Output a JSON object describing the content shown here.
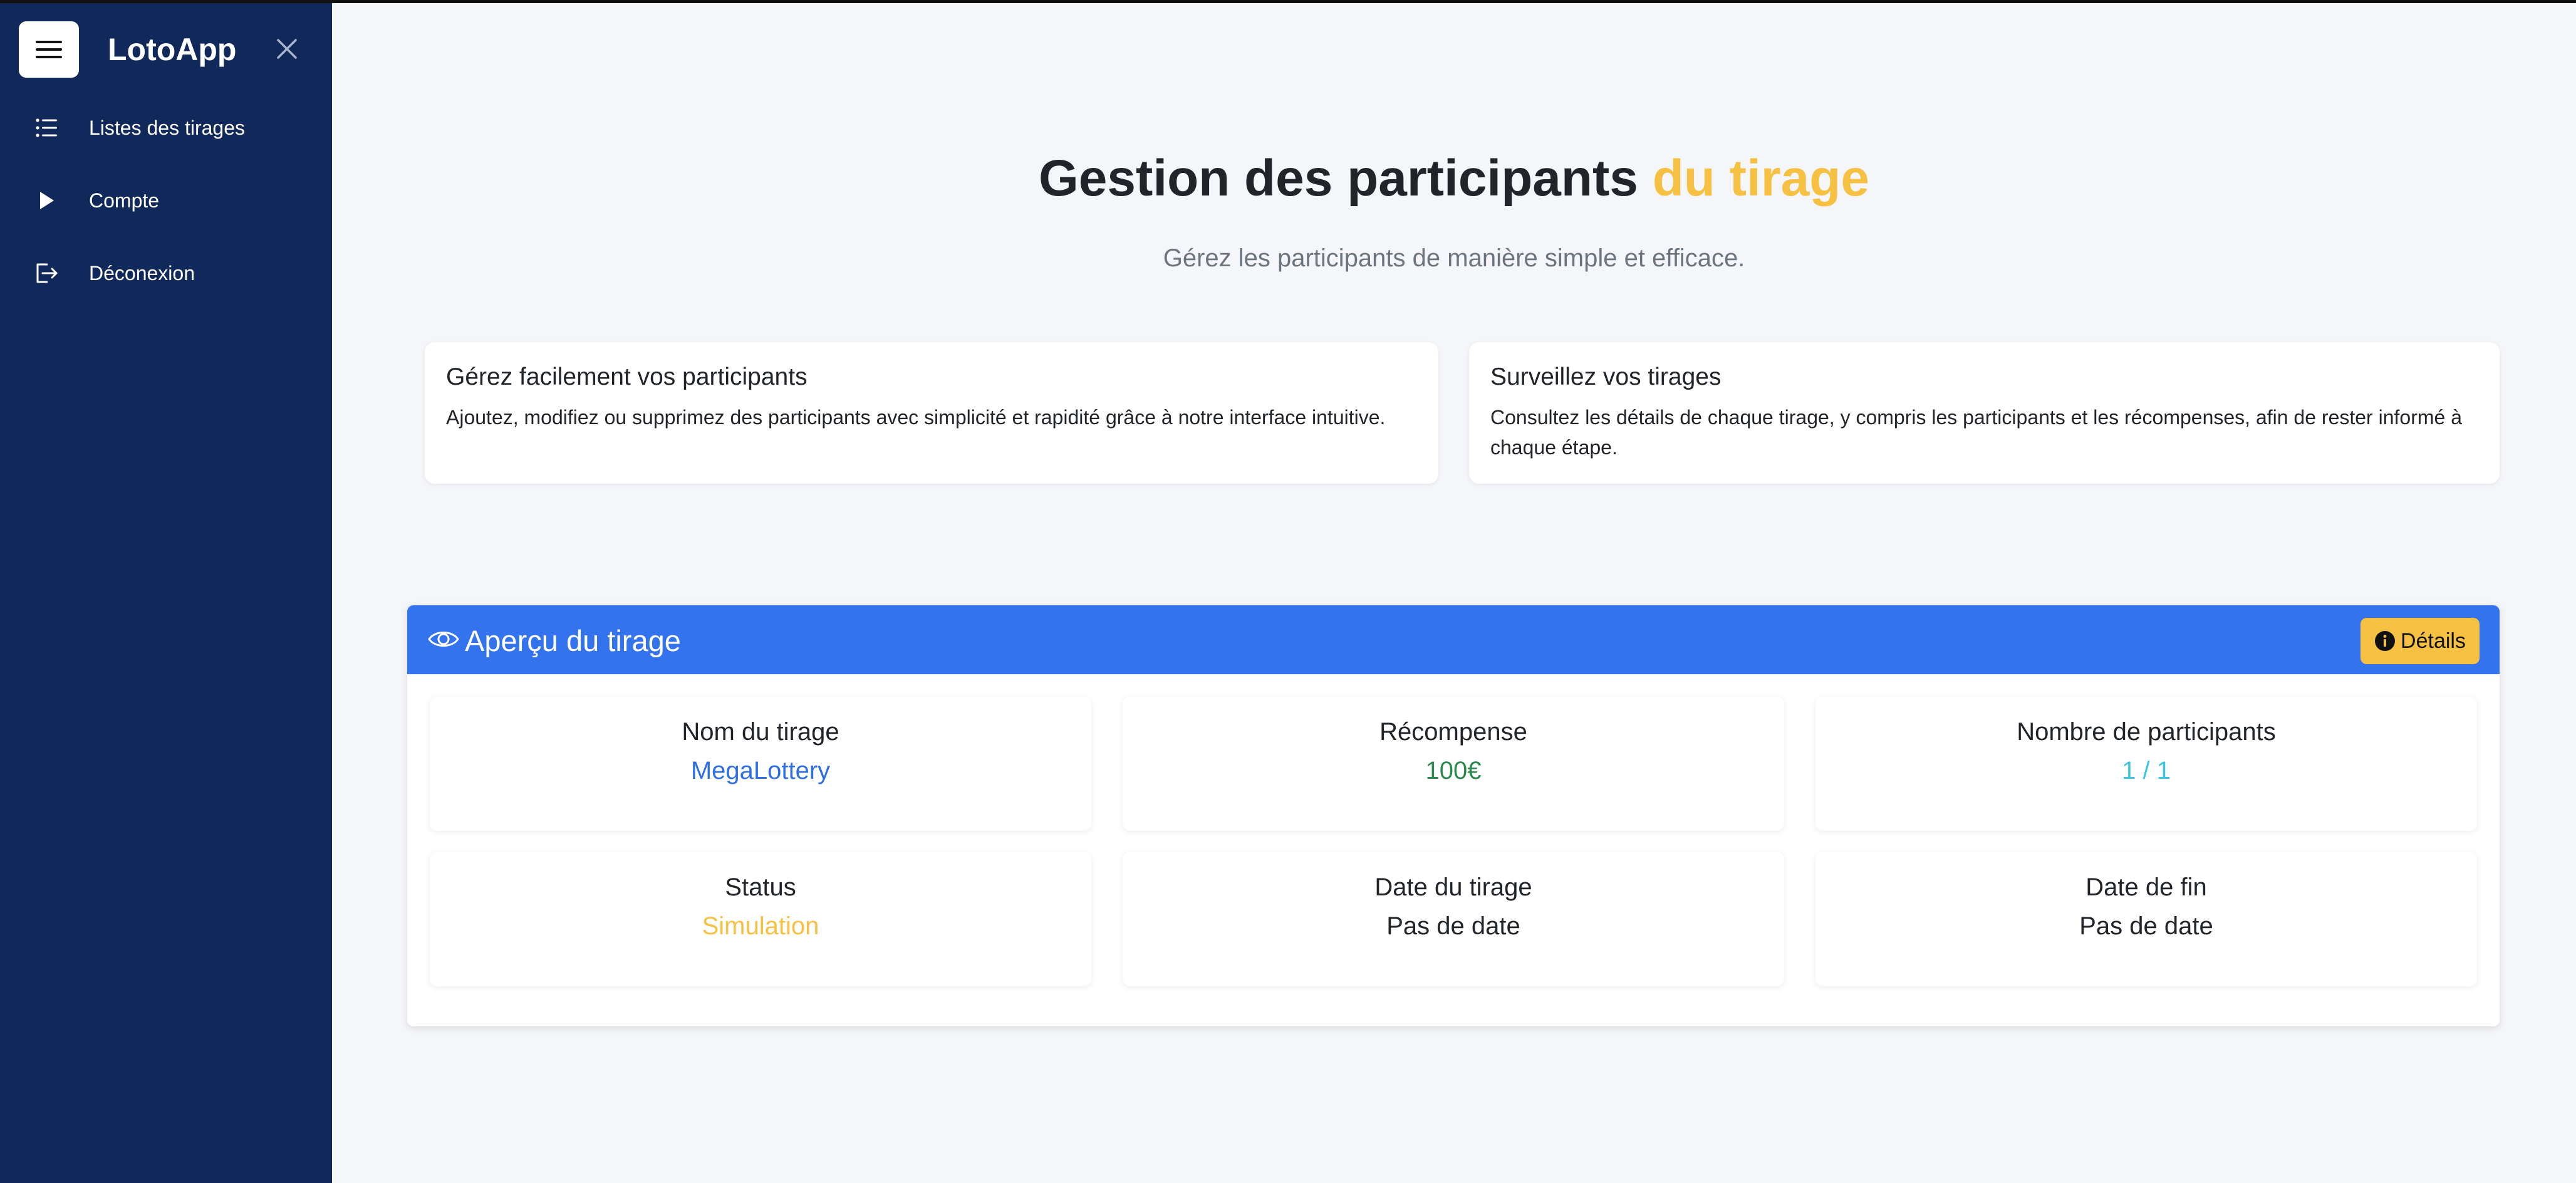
{
  "app": {
    "brand": "LotoApp"
  },
  "sidebar": {
    "items": [
      {
        "label": "Listes des tirages",
        "icon": "list-icon"
      },
      {
        "label": "Compte",
        "icon": "play-icon"
      },
      {
        "label": "Déconexion",
        "icon": "logout-icon"
      }
    ]
  },
  "hero": {
    "title_main": "Gestion des participants",
    "title_accent": "du tirage",
    "subtitle": "Gérez les participants de manière simple et efficace."
  },
  "features": [
    {
      "title": "Gérez facilement vos participants",
      "text": "Ajoutez, modifiez ou supprimez des participants avec simplicité et rapidité grâce à notre interface intuitive."
    },
    {
      "title": "Surveillez vos tirages",
      "text": "Consultez les détails de chaque tirage, y compris les participants et les récompenses, afin de rester informé à chaque étape."
    }
  ],
  "overview": {
    "title": "Aperçu du tirage",
    "details_label": "Détails",
    "stats": [
      {
        "label": "Nom du tirage",
        "value": "MegaLottery",
        "color": "#2f6fe4"
      },
      {
        "label": "Récompense",
        "value": "100€",
        "color": "#2d8a4e"
      },
      {
        "label": "Nombre de participants",
        "value": "1 / 1",
        "color": "#3cc4e4"
      },
      {
        "label": "Status",
        "value": "Simulation",
        "color": "#f6c142"
      },
      {
        "label": "Date du tirage",
        "value": "Pas de date",
        "color": "#212529"
      },
      {
        "label": "Date de fin",
        "value": "Pas de date",
        "color": "#212529"
      }
    ]
  },
  "colors": {
    "sidebar_bg": "#10295a",
    "accent_yellow": "#f6c142",
    "panel_header_blue": "#3373ee",
    "page_bg": "#f5f6f9"
  }
}
